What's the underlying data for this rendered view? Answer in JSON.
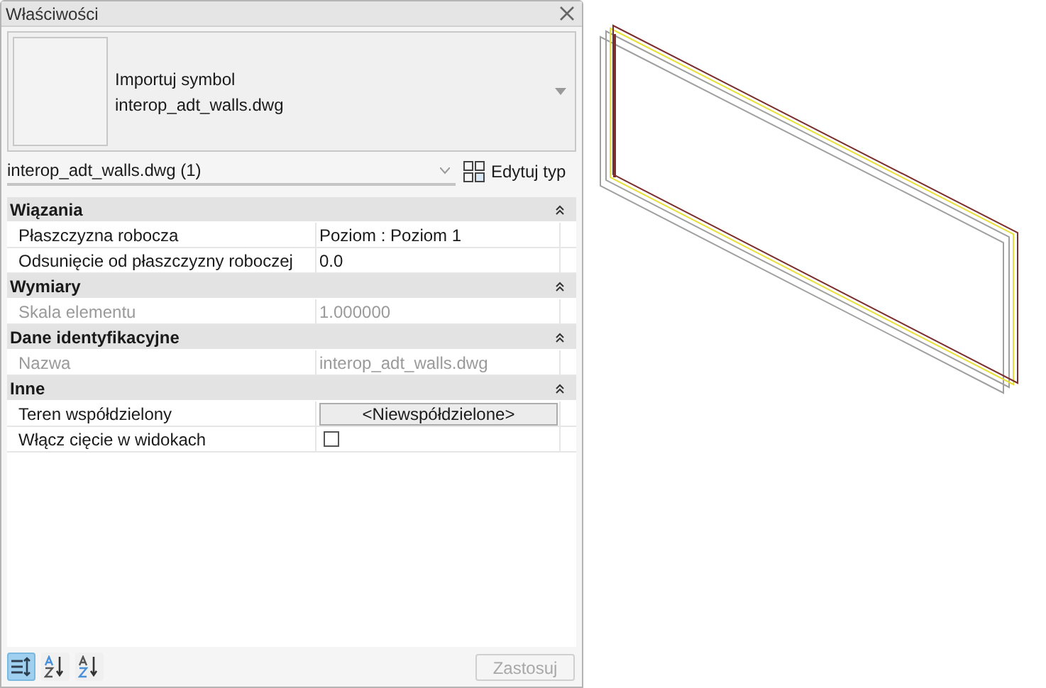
{
  "panel": {
    "title": "Właściwości",
    "type_preview": {
      "line1": "Importuj symbol",
      "line2": "interop_adt_walls.dwg"
    },
    "instance_selector": "interop_adt_walls.dwg (1)",
    "edit_type": "Edytuj typ",
    "groups": [
      {
        "name": "Wiązania",
        "expanded": true,
        "rows": [
          {
            "label": "Płaszczyzna robocza",
            "value": "Poziom : Poziom 1",
            "kind": "text",
            "disabled": false
          },
          {
            "label": "Odsunięcie od płaszczyzny roboczej",
            "value": "0.0",
            "kind": "text",
            "disabled": false
          }
        ]
      },
      {
        "name": "Wymiary",
        "expanded": true,
        "rows": [
          {
            "label": "Skala elementu",
            "value": "1.000000",
            "kind": "text",
            "disabled": true
          }
        ]
      },
      {
        "name": "Dane identyfikacyjne",
        "expanded": true,
        "rows": [
          {
            "label": "Nazwa",
            "value": "interop_adt_walls.dwg",
            "kind": "text",
            "disabled": true
          }
        ]
      },
      {
        "name": "Inne",
        "expanded": true,
        "rows": [
          {
            "label": "Teren współdzielony",
            "value": "<Niewspółdzielone>",
            "kind": "button",
            "disabled": false
          },
          {
            "label": "Włącz cięcie w widokach",
            "kind": "checkbox",
            "checked": false,
            "disabled": false
          }
        ]
      }
    ],
    "sort_buttons": [
      {
        "kind": "category",
        "selected": true
      },
      {
        "kind": "az",
        "selected": false
      },
      {
        "kind": "za",
        "selected": false
      }
    ],
    "apply": {
      "label": "Zastosuj",
      "disabled": true
    }
  }
}
